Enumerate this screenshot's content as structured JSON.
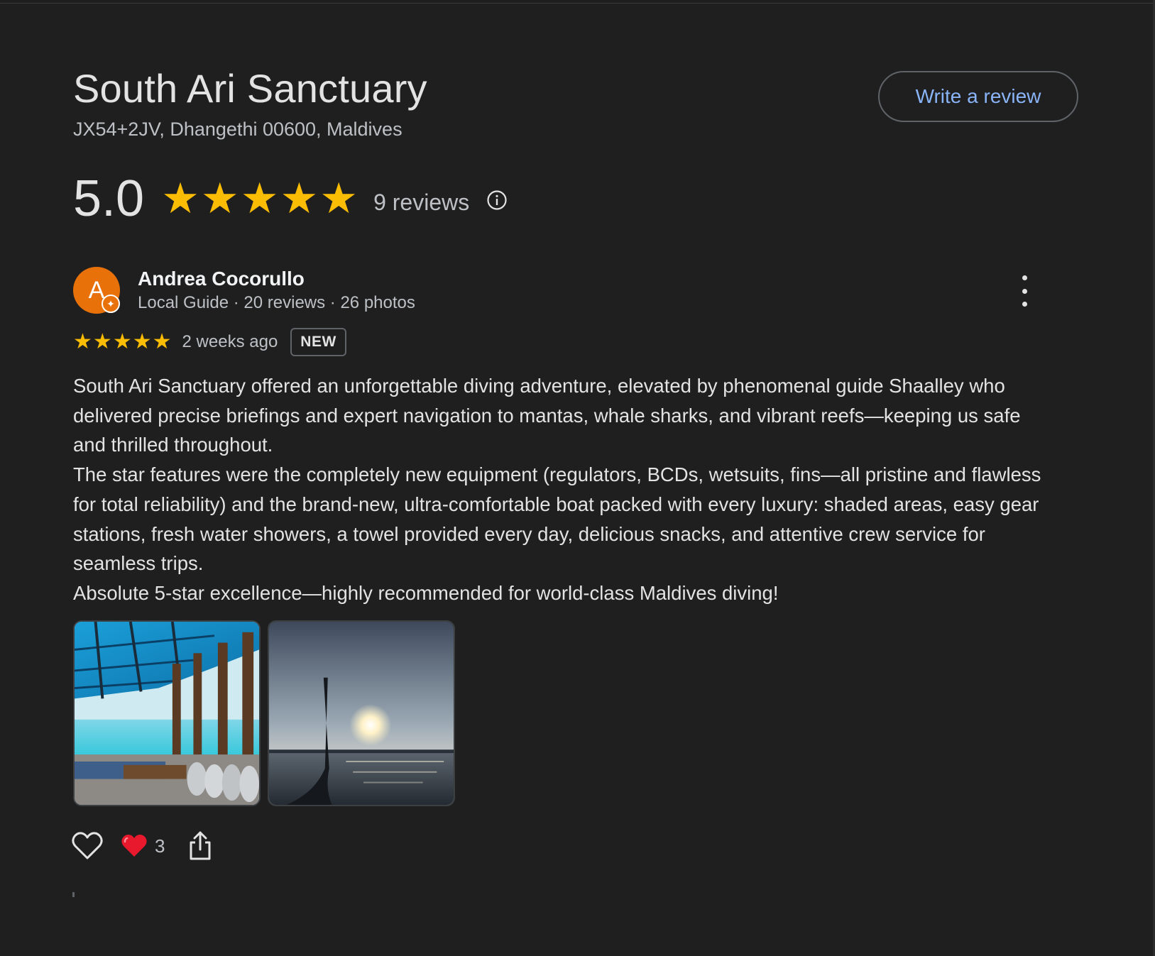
{
  "place": {
    "title": "South Ari Sanctuary",
    "address": "JX54+2JV, Dhangethi 00600, Maldives",
    "write_review_label": "Write a review"
  },
  "rating": {
    "value": "5.0",
    "stars": 5,
    "count_label": "9 reviews"
  },
  "review": {
    "avatar_letter": "A",
    "author": "Andrea Cocorullo",
    "author_meta": "Local Guide · 20 reviews · 26 photos",
    "stars": 5,
    "time": "2 weeks ago",
    "badge": "NEW",
    "paragraphs": [
      "South Ari Sanctuary offered an unforgettable diving adventure, elevated by phenomenal guide Shaalley who delivered precise briefings and expert navigation to mantas, whale sharks, and vibrant reefs—keeping us safe and thrilled throughout.",
      "The star features were the completely new equipment (regulators, BCDs, wetsuits, fins—all pristine and flawless for total reliability) and the brand-new, ultra-comfortable boat packed with every luxury: shaded areas, easy gear stations, fresh water showers, a towel provided every day, delicious snacks, and attentive crew service for seamless trips.",
      "Absolute 5-star excellence—highly recommended for world-class Maldives diving!"
    ],
    "like_count": "3"
  },
  "icons": {
    "star": "star-icon",
    "info": "info-icon",
    "more": "more-vert-icon",
    "like": "heart-outline-icon",
    "reaction": "red-heart-icon",
    "share": "share-icon"
  },
  "colors": {
    "background": "#1f1f1f",
    "star": "#fbbc04",
    "link": "#8ab4f8",
    "avatar": "#e8710a",
    "reaction": "#e8192c"
  }
}
